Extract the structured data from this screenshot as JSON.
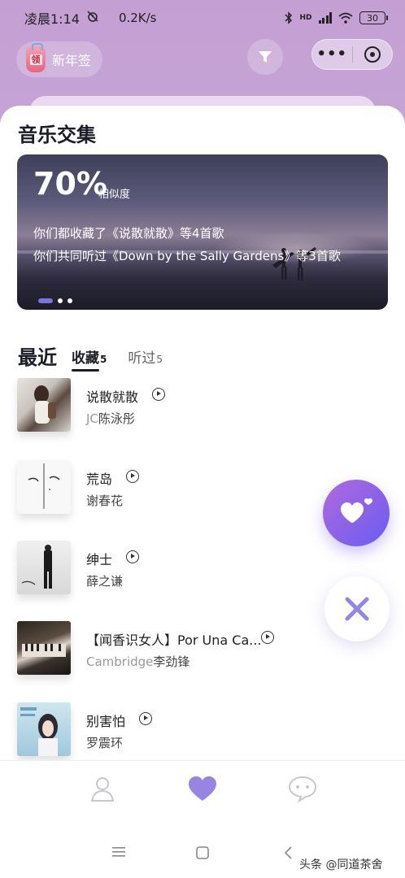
{
  "status": {
    "time": "凌晨1:14",
    "speed": "0.2K/s",
    "network": "HD",
    "battery": "30"
  },
  "header": {
    "badge_label": "新年签",
    "badge_glyph": "领"
  },
  "section_title": "音乐交集",
  "banner": {
    "percent": "70%",
    "percent_label": "相似度",
    "line1": "你们都收藏了《说散就散》等4首歌",
    "line2": "你们共同听过《Down by the Sally Gardens》等3首歌",
    "active_dot": 0
  },
  "recent": {
    "title": "最近",
    "tabs": [
      {
        "label": "收藏",
        "count": "5",
        "active": true
      },
      {
        "label": "听过",
        "count": "5",
        "active": false
      }
    ]
  },
  "songs": [
    {
      "name": "说散就散",
      "artist_latin": "JC",
      "artist": "陈泳彤"
    },
    {
      "name": "荒岛",
      "artist_latin": "",
      "artist": "谢春花"
    },
    {
      "name": "绅士",
      "artist_latin": "",
      "artist": "薛之谦"
    },
    {
      "name": "【闻香识女人】Por Una Ca...",
      "artist_latin": "Cambridge",
      "artist": "李劲锋"
    },
    {
      "name": "别害怕",
      "artist_latin": "",
      "artist": "罗震环"
    }
  ],
  "watermark": "头条 @同道茶舍",
  "colors": {
    "header_bg": "#c49fd3",
    "accent": "#7b74e0",
    "like_gradient_start": "#b06ae0",
    "like_gradient_end": "#6a5cf0"
  },
  "icons": {
    "filter": "filter-icon",
    "more": "more-icon",
    "close_mini": "target-icon",
    "like": "heart-icon",
    "dislike": "close-icon",
    "tab_profile": "person-icon",
    "tab_match": "heart-icon",
    "tab_chat": "chat-icon"
  }
}
